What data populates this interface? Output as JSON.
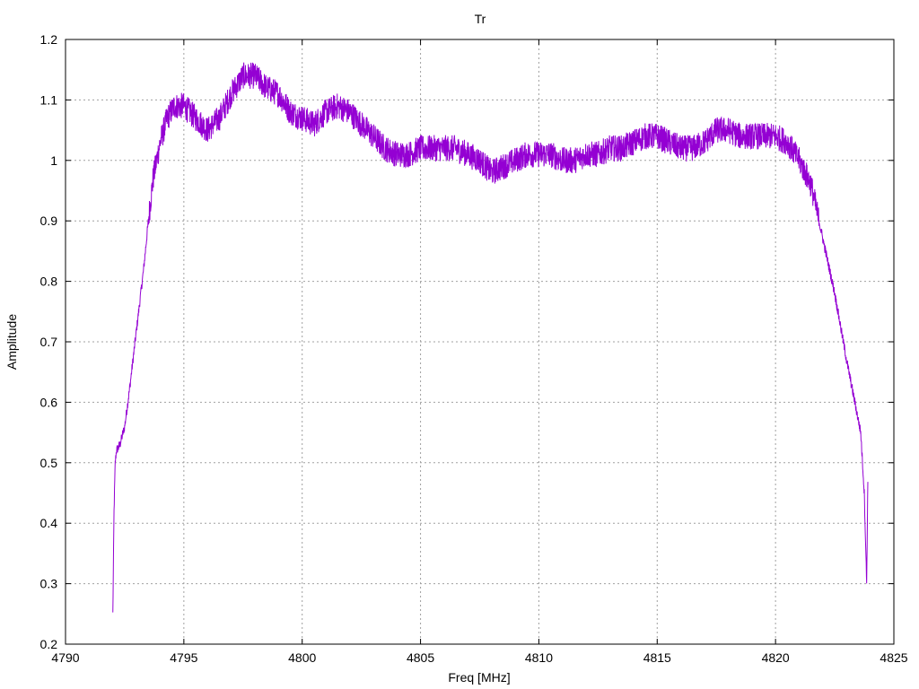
{
  "chart_data": {
    "type": "line",
    "title": "Tr",
    "xlabel": "Freq [MHz]",
    "ylabel": "Amplitude",
    "xlim": [
      4790,
      4825
    ],
    "ylim": [
      0.2,
      1.2
    ],
    "xticks": [
      4790,
      4795,
      4800,
      4805,
      4810,
      4815,
      4820,
      4825
    ],
    "yticks": [
      0.2,
      0.3,
      0.4,
      0.5,
      0.6,
      0.7,
      0.8,
      0.9,
      1,
      1.1,
      1.2
    ],
    "ytick_labels": [
      "0.2",
      "0.3",
      "0.4",
      "0.5",
      "0.6",
      "0.7",
      "0.8",
      "0.9",
      "1",
      "1.1",
      "1.2"
    ],
    "grid": true,
    "series": [
      {
        "color": "#9400d3",
        "x": [
          4792.0,
          4792.05,
          4792.1,
          4792.15,
          4792.3,
          4792.5,
          4792.7,
          4793.0,
          4793.3,
          4793.5,
          4793.7,
          4794.0,
          4794.3,
          4794.6,
          4795.0,
          4795.5,
          4796.0,
          4796.5,
          4797.0,
          4797.5,
          4798.0,
          4798.5,
          4799.0,
          4799.5,
          4800.0,
          4800.5,
          4801.0,
          4801.5,
          4802.0,
          4802.5,
          4803.0,
          4803.5,
          4804.0,
          4804.5,
          4805.0,
          4805.5,
          4806.0,
          4806.5,
          4807.0,
          4807.5,
          4808.0,
          4808.5,
          4809.0,
          4809.5,
          4810.0,
          4810.5,
          4811.0,
          4811.5,
          4812.0,
          4812.5,
          4813.0,
          4813.5,
          4814.0,
          4814.5,
          4815.0,
          4815.5,
          4816.0,
          4816.5,
          4817.0,
          4817.5,
          4818.0,
          4818.5,
          4819.0,
          4819.5,
          4820.0,
          4820.5,
          4821.0,
          4821.5,
          4822.0,
          4822.5,
          4823.0,
          4823.3,
          4823.6,
          4823.75,
          4823.85,
          4823.9
        ],
        "y": [
          0.25,
          0.42,
          0.5,
          0.52,
          0.53,
          0.56,
          0.62,
          0.72,
          0.82,
          0.9,
          0.97,
          1.03,
          1.07,
          1.09,
          1.09,
          1.07,
          1.05,
          1.07,
          1.11,
          1.14,
          1.14,
          1.12,
          1.11,
          1.08,
          1.07,
          1.06,
          1.08,
          1.09,
          1.08,
          1.06,
          1.04,
          1.02,
          1.01,
          1.01,
          1.02,
          1.02,
          1.02,
          1.02,
          1.01,
          1.0,
          0.98,
          0.99,
          1.0,
          1.01,
          1.01,
          1.01,
          1.0,
          1.0,
          1.01,
          1.01,
          1.02,
          1.02,
          1.03,
          1.04,
          1.04,
          1.03,
          1.02,
          1.02,
          1.03,
          1.05,
          1.05,
          1.04,
          1.04,
          1.04,
          1.04,
          1.03,
          1.0,
          0.96,
          0.87,
          0.78,
          0.67,
          0.61,
          0.55,
          0.45,
          0.3,
          0.47
        ]
      }
    ]
  }
}
